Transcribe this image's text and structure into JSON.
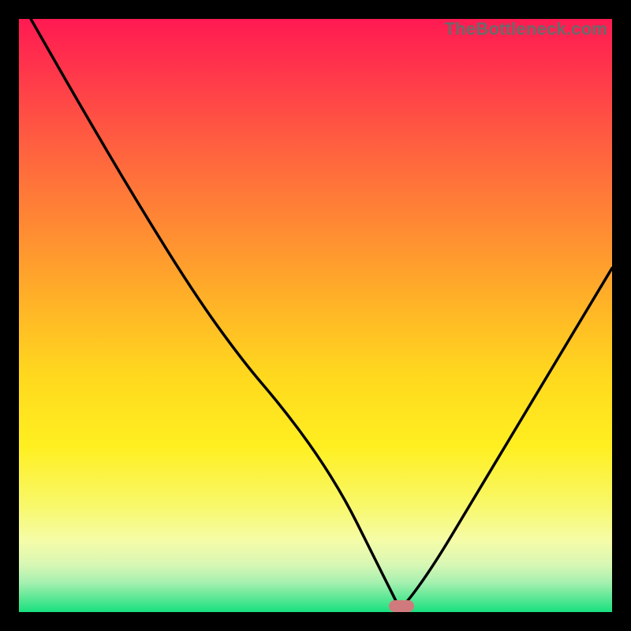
{
  "watermark": {
    "text": "TheBottleneck.com"
  },
  "chart_data": {
    "type": "line",
    "title": "",
    "xlabel": "",
    "ylabel": "",
    "xlim": [
      0,
      100
    ],
    "ylim": [
      0,
      100
    ],
    "grid": false,
    "legend": false,
    "x": [
      2,
      10,
      20,
      30,
      38,
      44,
      50,
      55,
      59,
      63,
      64,
      65,
      70,
      76,
      82,
      88,
      94,
      100
    ],
    "values": [
      100,
      86,
      69,
      53,
      42,
      35,
      27,
      19,
      11,
      3,
      1,
      1,
      8,
      18,
      28,
      38,
      48,
      58
    ],
    "marker": {
      "x": 64.5,
      "y": 1,
      "w_pct": 4.2,
      "h_pct": 2.0,
      "color": "#d17a7d"
    },
    "gradient_stops": [
      {
        "offset": "0%",
        "color": "#ff1a52"
      },
      {
        "offset": "10%",
        "color": "#ff3a4a"
      },
      {
        "offset": "22%",
        "color": "#ff623f"
      },
      {
        "offset": "35%",
        "color": "#ff8a33"
      },
      {
        "offset": "48%",
        "color": "#ffb327"
      },
      {
        "offset": "60%",
        "color": "#ffd81e"
      },
      {
        "offset": "72%",
        "color": "#ffef20"
      },
      {
        "offset": "82%",
        "color": "#f8f86a"
      },
      {
        "offset": "88%",
        "color": "#f5fca8"
      },
      {
        "offset": "92%",
        "color": "#d8f7b4"
      },
      {
        "offset": "95%",
        "color": "#a6f0b0"
      },
      {
        "offset": "100%",
        "color": "#18e07e"
      }
    ]
  }
}
